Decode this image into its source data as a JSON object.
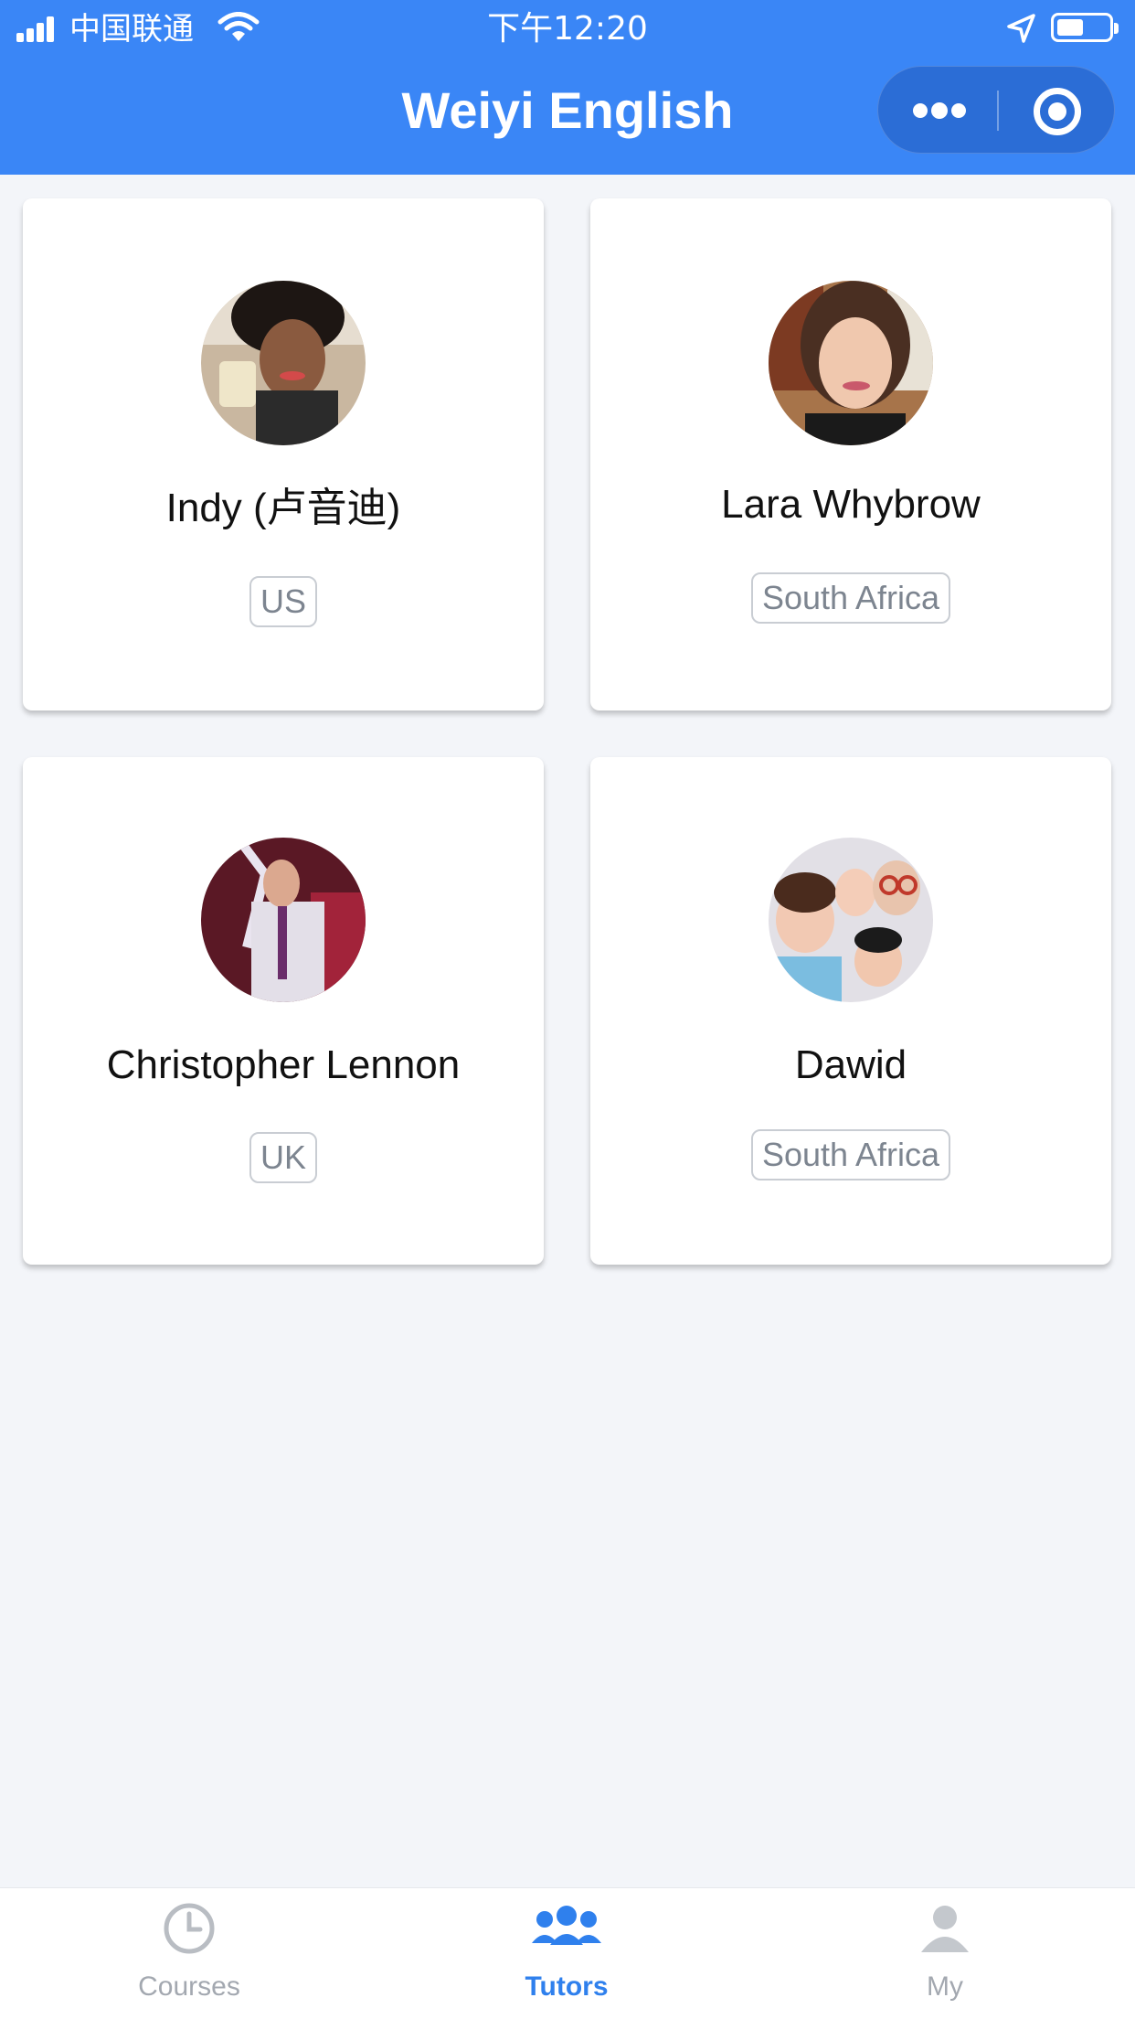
{
  "status_bar": {
    "carrier": "中国联通",
    "time": "下午12:20"
  },
  "nav": {
    "title": "Weiyi English"
  },
  "tutors": [
    {
      "name": "Indy (卢音迪)",
      "country": "US"
    },
    {
      "name": "Lara Whybrow",
      "country": "South Africa"
    },
    {
      "name": "Christopher Lennon",
      "country": "UK"
    },
    {
      "name": "Dawid",
      "country": "South Africa"
    }
  ],
  "tabbar": {
    "items": [
      {
        "label": "Courses",
        "icon": "clock-icon",
        "active": false
      },
      {
        "label": "Tutors",
        "icon": "people-icon",
        "active": true
      },
      {
        "label": "My",
        "icon": "person-icon",
        "active": false
      }
    ]
  },
  "colors": {
    "brand": "#3a86f6",
    "active_tab": "#2f80ed",
    "inactive_tab": "#a3a8b0",
    "background": "#f3f5f9"
  }
}
